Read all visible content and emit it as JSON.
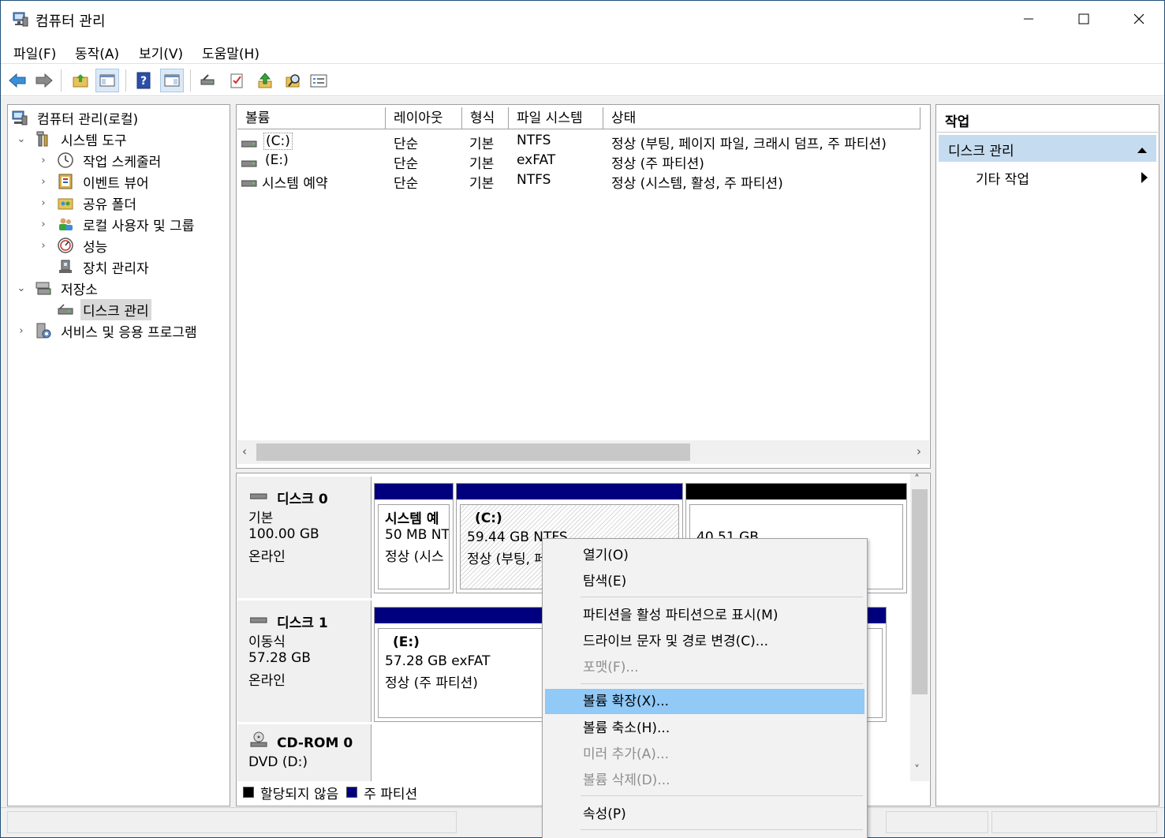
{
  "window": {
    "title": "컴퓨터 관리"
  },
  "menu": [
    "파일(F)",
    "동작(A)",
    "보기(V)",
    "도움말(H)"
  ],
  "toolbar": {
    "icons": [
      "back-arrow-icon",
      "forward-arrow-icon",
      "up-folder-icon",
      "show-hide-console-tree-icon",
      "help-icon",
      "show-hide-action-pane-icon",
      "connect-drive-icon",
      "checklist-icon",
      "green-up-arrow-icon",
      "search-folder-icon",
      "properties-icon"
    ]
  },
  "tree": {
    "root": "컴퓨터 관리(로컬)",
    "system_tools": "시스템 도구",
    "task_scheduler": "작업 스케줄러",
    "event_viewer": "이벤트 뷰어",
    "shared_folders": "공유 폴더",
    "local_users": "로컬 사용자 및 그룹",
    "performance": "성능",
    "device_manager": "장치 관리자",
    "storage": "저장소",
    "disk_management": "디스크 관리",
    "services": "서비스 및 응용 프로그램"
  },
  "volume_list": {
    "columns": [
      "볼륨",
      "레이아웃",
      "형식",
      "파일 시스템",
      "상태"
    ],
    "rows": [
      {
        "volume": "(C:)",
        "layout": "단순",
        "type": "기본",
        "fs": "NTFS",
        "status": "정상 (부팅, 페이지 파일, 크래시 덤프, 주 파티션)"
      },
      {
        "volume": "(E:)",
        "layout": "단순",
        "type": "기본",
        "fs": "exFAT",
        "status": "정상 (주 파티션)"
      },
      {
        "volume": "시스템 예약",
        "layout": "단순",
        "type": "기본",
        "fs": "NTFS",
        "status": "정상 (시스템, 활성, 주 파티션)"
      }
    ]
  },
  "disks": [
    {
      "name": "디스크 0",
      "kind": "기본",
      "size": "100.00 GB",
      "state": "온라인",
      "partitions": [
        {
          "title": "시스템 예",
          "line1": "50 MB NT",
          "line2": "정상 (시스"
        },
        {
          "title": "(C:)",
          "line1": "59.44 GB NTFS",
          "line2": "정상 (부팅, 페"
        },
        {
          "title": "",
          "line1": "40.51 GB",
          "line2": ""
        }
      ]
    },
    {
      "name": "디스크 1",
      "kind": "이동식",
      "size": "57.28 GB",
      "state": "온라인",
      "partitions": [
        {
          "title": "(E:)",
          "line1": "57.28 GB exFAT",
          "line2": "정상 (주 파티션)"
        }
      ]
    },
    {
      "name": "CD-ROM 0",
      "kind": "DVD (D:)"
    }
  ],
  "legend": {
    "unallocated": "할당되지 않음",
    "primary": "주 파티션"
  },
  "actions": {
    "header": "작업",
    "section": "디스크 관리",
    "more": "기타 작업"
  },
  "context_menu": {
    "open": "열기(O)",
    "explore": "탐색(E)",
    "mark_active": "파티션을 활성 파티션으로 표시(M)",
    "change_letter": "드라이브 문자 및 경로 변경(C)...",
    "format": "포맷(F)...",
    "extend": "볼륨 확장(X)...",
    "shrink": "볼륨 축소(H)...",
    "add_mirror": "미러 추가(A)...",
    "delete": "볼륨 삭제(D)...",
    "properties": "속성(P)"
  },
  "colors": {
    "primary_partition": "#00007f",
    "unallocated": "#000000",
    "highlight": "#91c9f7",
    "action_section": "#c5dcf0"
  }
}
